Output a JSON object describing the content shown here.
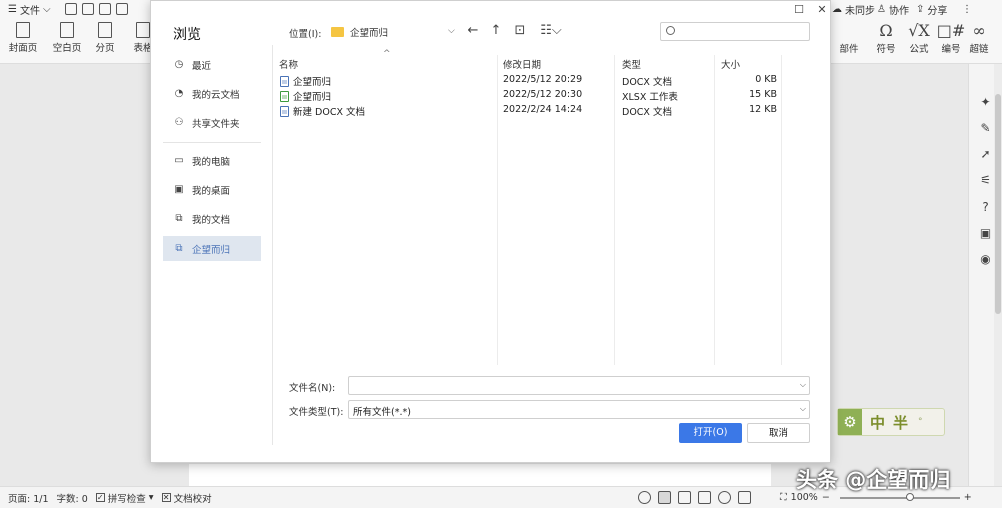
{
  "app": {
    "file_menu": "文件",
    "unsync": "未同步",
    "collab": "协作",
    "share": "分享",
    "ribbon": {
      "cover_page": "封面页",
      "blank_page": "空白页",
      "page_break": "分页",
      "table": "表格",
      "parts": "部件",
      "symbol": "符号",
      "formula": "公式",
      "numbering": "编号",
      "hyperlink": "超链"
    }
  },
  "dialog": {
    "title": "浏览",
    "location_label": "位置(I):",
    "location_value": "企望而归",
    "search_placeholder": "",
    "sidebar": [
      {
        "label": "最近"
      },
      {
        "label": "我的云文档"
      },
      {
        "label": "共享文件夹"
      },
      {
        "label": "我的电脑"
      },
      {
        "label": "我的桌面"
      },
      {
        "label": "我的文档"
      },
      {
        "label": "企望而归",
        "selected": true
      }
    ],
    "columns": {
      "name": "名称",
      "modified": "修改日期",
      "type": "类型",
      "size": "大小"
    },
    "files": [
      {
        "name": "企望而归",
        "modified": "2022/5/12 20:29",
        "type": "DOCX 文档",
        "size": "0 KB",
        "icon": "docx-file-icon"
      },
      {
        "name": "企望而归",
        "modified": "2022/5/12 20:30",
        "type": "XLSX 工作表",
        "size": "15 KB",
        "icon": "xlsx-file-icon"
      },
      {
        "name": "新建 DOCX 文档",
        "modified": "2022/2/24 14:24",
        "type": "DOCX 文档",
        "size": "12 KB",
        "icon": "docx-file-icon"
      }
    ],
    "filename_label": "文件名(N):",
    "filename_value": "",
    "filetype_label": "文件类型(T):",
    "filetype_value": "所有文件(*.*)",
    "open_button": "打开(O)",
    "cancel_button": "取消",
    "accent": "#3b78e7"
  },
  "status": {
    "page": "页面: 1/1",
    "words": "字数: 0",
    "spellcheck": "拼写检查",
    "proofread": "文档校对",
    "zoom": "100%"
  },
  "widget": {
    "text": "中半"
  },
  "watermark": "头条 @企望而归"
}
